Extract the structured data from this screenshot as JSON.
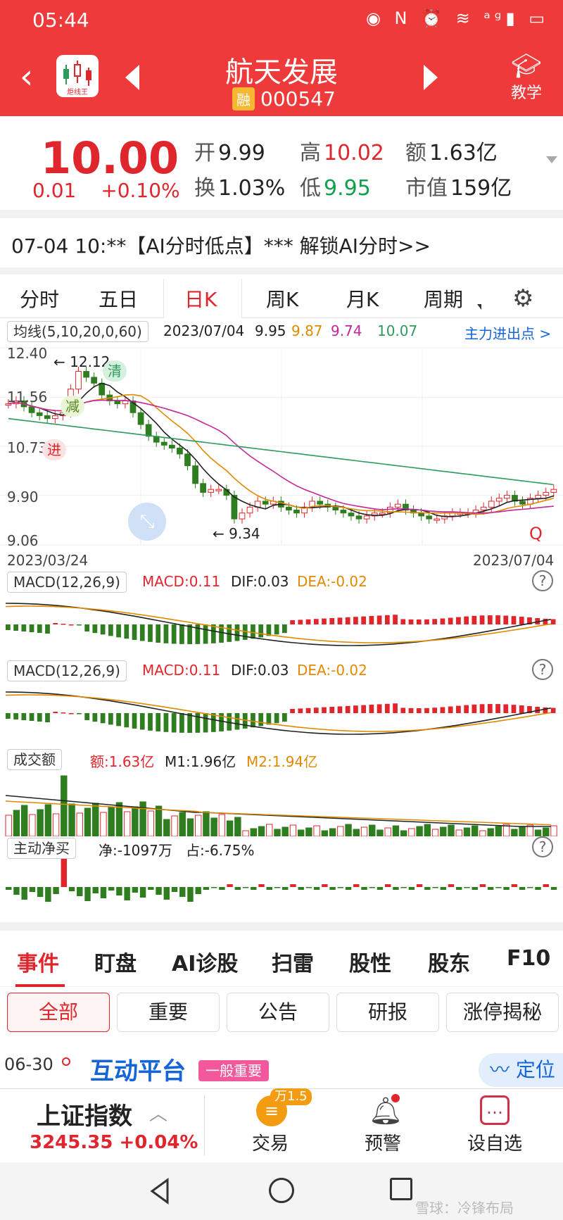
{
  "status": {
    "time": "05:44",
    "icons": "◉ N ⏰ ≋ ᵃᵍ▮ ▭"
  },
  "header": {
    "title": "航天发展",
    "margin_tag": "融",
    "code": "000547",
    "logo_text": "炬线王",
    "teach_label": "教学"
  },
  "quote": {
    "price": "10.00",
    "change": "0.01",
    "change_pct": "+0.10%",
    "open_label": "开",
    "open": "9.99",
    "high_label": "高",
    "high": "10.02",
    "amount_label": "额",
    "amount": "1.63亿",
    "turnover_label": "换",
    "turnover": "1.03%",
    "low_label": "低",
    "low": "9.95",
    "mktcap_label": "市值",
    "mktcap": "159亿"
  },
  "news_line": "07-04 10:**【AI分时低点】*** 解锁AI分时>>",
  "chart_tabs": [
    "分时",
    "五日",
    "日K",
    "周K",
    "月K",
    "周期"
  ],
  "chart": {
    "ma_chip": "均线(5,10,20,0,60)",
    "ma_date": "2023/07/04",
    "ma_values": [
      "9.95",
      "9.87",
      "9.74",
      "10.07"
    ],
    "ma_colors": [
      "#222222",
      "#e08a00",
      "#c2279b",
      "#2e9a5e"
    ],
    "main_flow": "主力进出点 >",
    "y_labels": [
      "12.40",
      "11.56",
      "10.73",
      "9.90",
      "9.06"
    ],
    "high_mark": "← 12.12",
    "low_mark": "← 9.34",
    "tag_clear": "清",
    "tag_reduce": "减",
    "tag_enter": "进",
    "q_mark": "Q",
    "x_start": "2023/03/24",
    "x_end": "2023/07/04"
  },
  "macd": {
    "chip": "MACD(12,26,9)",
    "macd": "MACD:0.11",
    "dif": "DIF:0.03",
    "dea": "DEA:-0.02"
  },
  "volume": {
    "chip": "成交额",
    "amount": "额:1.63亿",
    "m1": "M1:1.96亿",
    "m2": "M2:1.94亿"
  },
  "netbuy": {
    "chip": "主动净买",
    "net": "净:-1097万",
    "ratio": "占:-6.75%"
  },
  "section_tabs": [
    "事件",
    "盯盘",
    "AI诊股",
    "扫雷",
    "股性",
    "股东",
    "F10"
  ],
  "filters": [
    "全部",
    "重要",
    "公告",
    "研报",
    "涨停揭秘"
  ],
  "event": {
    "date": "06-30",
    "title": "互动平台",
    "badge": "一般重要",
    "locate": "定位"
  },
  "bottom": {
    "index_name": "上证指数",
    "index_value": "3245.35 +0.04%",
    "trade_badge": "万1.5",
    "trade": "交易",
    "alert": "预警",
    "watchlist": "设自选"
  },
  "watermark": "雪球：冷锋布局",
  "colors": {
    "up": "#e0262d",
    "down": "#2e7d1f",
    "header": "#ee3a3a"
  },
  "chart_data": [
    {
      "type": "candlestick",
      "title": "日K",
      "x_range": [
        "2023/03/24",
        "2023/07/04"
      ],
      "ylim": [
        9.06,
        12.4
      ],
      "y_ticks": [
        12.4,
        11.56,
        10.73,
        9.9,
        9.06
      ],
      "series": [
        {
          "name": "5",
          "last": 9.95
        },
        {
          "name": "10",
          "last": 9.87
        },
        {
          "name": "20",
          "last": 9.74
        },
        {
          "name": "60",
          "last": 10.07
        }
      ],
      "annotations": [
        "12.12",
        "9.34"
      ]
    },
    {
      "type": "bar",
      "title": "MACD(12,26,9)",
      "values": {
        "MACD": 0.11,
        "DIF": 0.03,
        "DEA": -0.02
      }
    },
    {
      "type": "bar",
      "title": "成交额",
      "values": {
        "额": "1.63亿",
        "M1": "1.96亿",
        "M2": "1.94亿"
      }
    },
    {
      "type": "bar",
      "title": "主动净买",
      "values": {
        "净": "-1097万",
        "占": "-6.75%"
      }
    }
  ]
}
